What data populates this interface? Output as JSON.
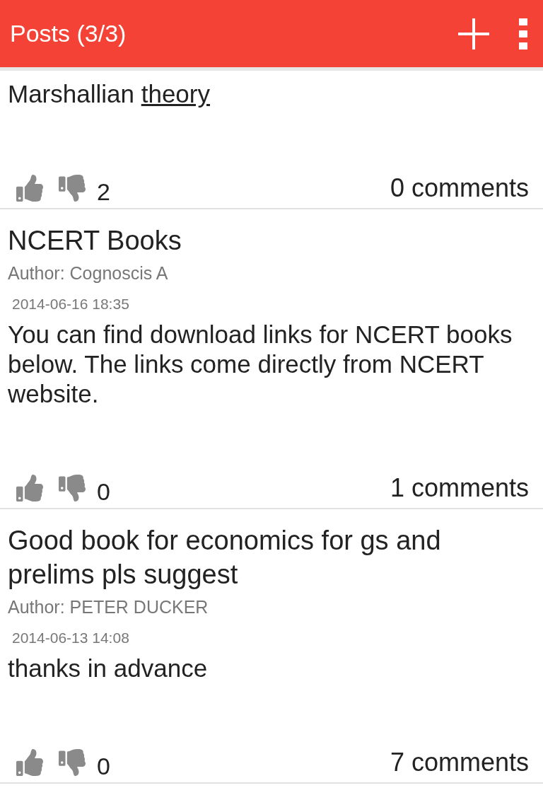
{
  "app_bar": {
    "title": "Posts (3/3)"
  },
  "posts": [
    {
      "body": "Marshallian ",
      "body_link": "theory",
      "votes": "2",
      "comments": "0 comments"
    },
    {
      "title": "NCERT Books",
      "author": "Author: Cognoscis A",
      "date": "2014-06-16  18:35",
      "body": "You can find download links for NCERT books below. The links come directly from NCERT website.",
      "votes": "0",
      "comments": "1 comments"
    },
    {
      "title": "Good book for economics for gs and prelims pls suggest",
      "author": "Author: PETER DUCKER",
      "date": "2014-06-13  14:08",
      "body": "thanks in advance",
      "votes": "0",
      "comments": "7 comments"
    }
  ]
}
